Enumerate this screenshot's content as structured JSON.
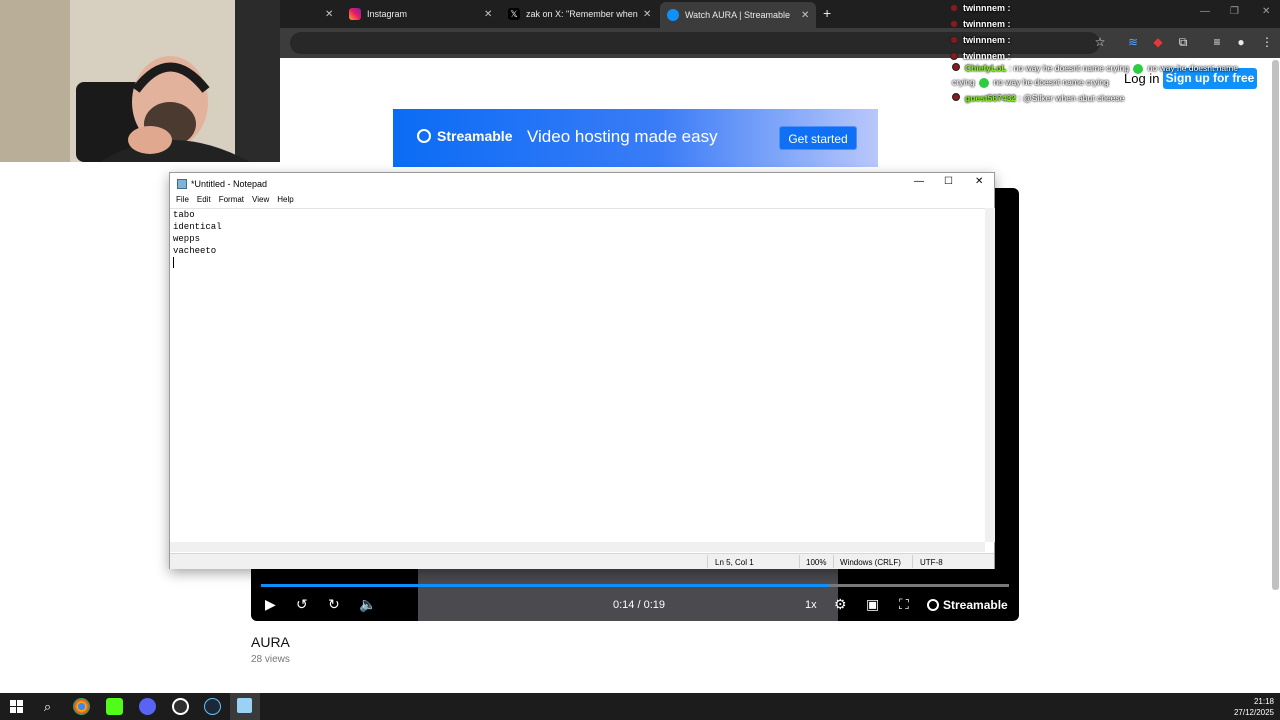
{
  "browser": {
    "tabs": [
      {
        "title": "",
        "active": false
      },
      {
        "title": "Instagram",
        "active": false
      },
      {
        "title": "zak on X: \"Remember when xQ",
        "active": false
      },
      {
        "title": "Watch AURA | Streamable",
        "active": true
      }
    ],
    "new_tab_label": "+"
  },
  "chat": {
    "user_lines": [
      "twinnnem :",
      "twinnnem :",
      "twinnnem :",
      "twinnnem :"
    ],
    "messages": [
      {
        "user": "ChiefyLoL",
        "text": ": no way he doesnt name crying",
        "emote_text": "no way he doesnt name"
      },
      {
        "user": "",
        "text": "crying",
        "emote_text": "no way he doesnt name crying"
      },
      {
        "user": "guest567432",
        "text": ": @Silker when abut cheese",
        "emote_text": ""
      }
    ]
  },
  "streamable": {
    "login_label": "Log in",
    "signup_label": "Sign up for free",
    "banner": {
      "logo_text": "Streamable",
      "tagline": "Video hosting made easy",
      "cta_label": "Get started"
    },
    "player": {
      "time": "0:14 / 0:19",
      "progress_fraction": 0.76,
      "speed": "1x",
      "brand": "Streamable"
    },
    "video_title": "AURA",
    "views": "28 views"
  },
  "notepad": {
    "title": "*Untitled - Notepad",
    "menu": [
      "File",
      "Edit",
      "Format",
      "View",
      "Help"
    ],
    "lines": [
      "tabo",
      "identical",
      "wepps",
      "vacheeto"
    ],
    "status": {
      "position": "Ln 5, Col 1",
      "zoom": "100%",
      "line_ending": "Windows (CRLF)",
      "encoding": "UTF-8"
    }
  },
  "taskbar": {
    "time": "21:18",
    "date": "27/12/2025",
    "apps": [
      "windows-start",
      "search",
      "chrome",
      "kick",
      "discord",
      "obs",
      "steam",
      "notepad"
    ]
  },
  "colors": {
    "accent": "#0f90fa",
    "tabbar": "#1f1f1f",
    "taskbar": "#1c1c1c"
  }
}
